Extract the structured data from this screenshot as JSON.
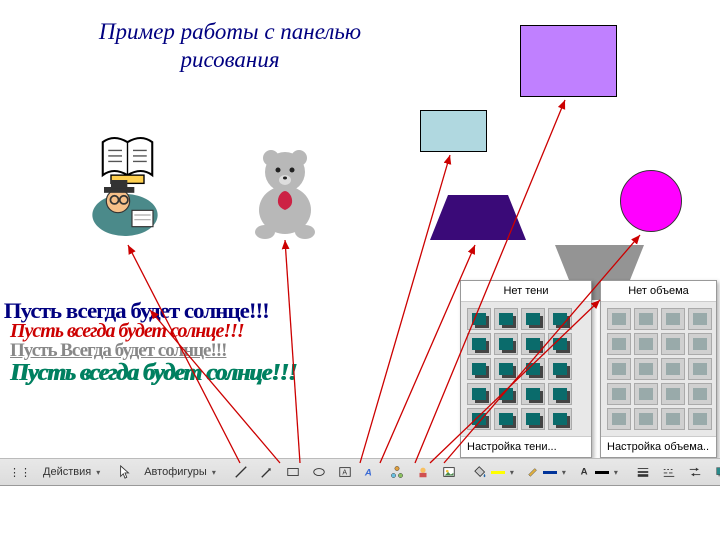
{
  "title_line1": "Пример работы с панелью",
  "title_line2": "рисования",
  "wordart": {
    "wa1": "Пусть всегда будет солнце!!!",
    "wa2": "Пусть всегда будет солнце!!!",
    "wa3": "Пусть Всегда будет солнце!!!",
    "wa4": "Пусть всегда будет солнце!!!"
  },
  "popup_shadow": {
    "caption": "Нет тени",
    "footer": "Настройка тени..."
  },
  "popup_volume": {
    "caption": "Нет объема",
    "footer": "Настройка объема.."
  },
  "toolbar": {
    "actions": "Действия",
    "autoshapes": "Автофигуры",
    "fill_color": "#ffff00",
    "line_color": "#003399",
    "font_color": "#000000"
  },
  "colors": {
    "rect_purple": "#c080ff",
    "rect_cyan": "#b0d8e0",
    "trapezoid": "#3a0a78",
    "circle": "#ff00ff"
  },
  "icons": {
    "pointer": "pointer-icon",
    "rotate": "rotate-icon",
    "line": "line-icon",
    "arrow": "arrow-icon",
    "rect": "rect-icon",
    "oval": "oval-icon",
    "textbox": "textbox-icon",
    "wordart": "wordart-icon",
    "diagram": "diagram-icon",
    "clipart": "clipart-icon",
    "picture": "picture-icon",
    "fill": "fill-icon",
    "linecolor": "linecolor-icon",
    "fontcolor": "fontcolor-icon",
    "linestyle": "linestyle-icon",
    "dashstyle": "dashstyle-icon",
    "arrowstyle": "arrowstyle-icon",
    "shadow": "shadow-icon",
    "threeD": "3d-icon"
  }
}
